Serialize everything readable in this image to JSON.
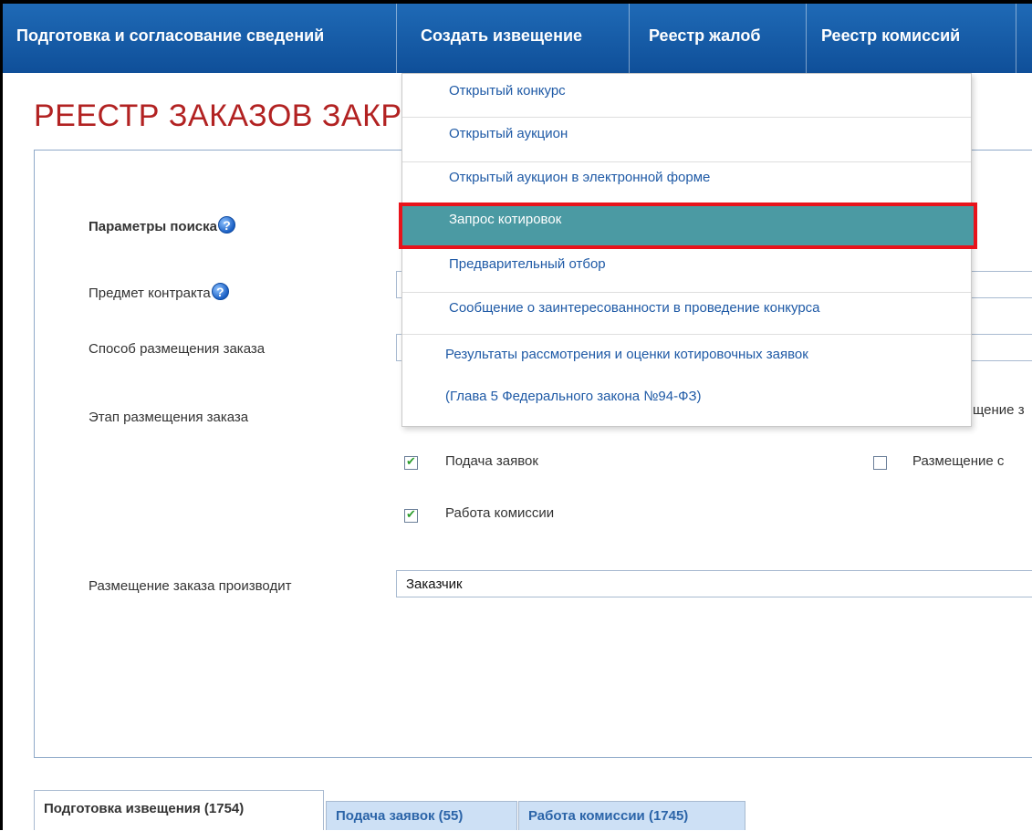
{
  "navbar": {
    "items": [
      "Подготовка и согласование сведений",
      "Создать извещение",
      "Реестр жалоб",
      "Реестр комиссий"
    ]
  },
  "page": {
    "title": "РЕЕСТР ЗАКАЗОВ ЗАКР"
  },
  "form": {
    "search_params_label": "Параметры поиска",
    "contract_subject_label": "Предмет контракта",
    "placement_method_label": "Способ размещения заказа",
    "placement_stage_label": "Этап размещения заказа",
    "stage_right_partial": "щение з",
    "checkbox_submission_label": "Подача заявок",
    "checkbox_commission_label": "Работа комиссии",
    "checkbox_right_label": "Размещение с",
    "placer_label": "Размещение заказа производит",
    "placer_value": "Заказчик",
    "help_glyph": "?"
  },
  "tabs": [
    "Подготовка извещения (1754)",
    "Подача заявок (55)",
    "Работа комиссии (1745)"
  ],
  "dropdown": {
    "items": [
      "Открытый конкурс",
      "Открытый аукцион",
      "Открытый аукцион в электронной форме",
      "Запрос котировок",
      "Предварительный отбор",
      "Сообщение о заинтересованности в проведение конкурса",
      "Результаты рассмотрения и оценки котировочных заявок",
      "(Глава 5 Федерального закона №94-ФЗ)"
    ]
  },
  "colors": {
    "navbar": "#1559a8",
    "title": "#b22222",
    "highlight": "#4b9aa3",
    "highlight_border": "#e8131b",
    "link": "#1f5aa6"
  }
}
